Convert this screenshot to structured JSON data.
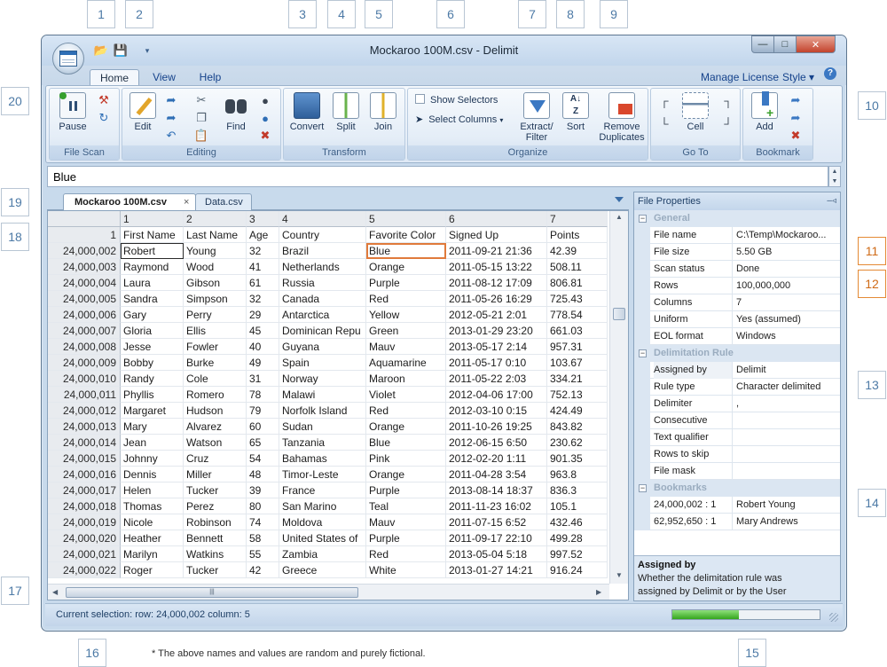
{
  "callouts": [
    "1",
    "2",
    "3",
    "4",
    "5",
    "6",
    "7",
    "8",
    "9",
    "10",
    "11",
    "12",
    "13",
    "14",
    "15",
    "16",
    "17",
    "18",
    "19",
    "20"
  ],
  "window": {
    "title": "Mockaroo 100M.csv - Delimit"
  },
  "tabs": {
    "home": "Home",
    "view": "View",
    "help": "Help",
    "manage_license": "Manage License",
    "style": "Style ▾",
    "help_icon": "?"
  },
  "ribbon": {
    "file_scan": {
      "label": "File Scan",
      "pause": "Pause"
    },
    "editing": {
      "label": "Editing",
      "edit": "Edit",
      "find": "Find"
    },
    "transform": {
      "label": "Transform",
      "convert": "Convert",
      "split": "Split",
      "join": "Join"
    },
    "organize": {
      "label": "Organize",
      "show_selectors": "Show Selectors",
      "select_columns": "Select Columns",
      "extract_filter_1": "Extract/",
      "extract_filter_2": "Filter",
      "sort": "Sort",
      "remove_dup_1": "Remove",
      "remove_dup_2": "Duplicates"
    },
    "goto": {
      "label": "Go To",
      "cell": "Cell"
    },
    "bookmark": {
      "label": "Bookmark",
      "add": "Add"
    }
  },
  "value_bar": {
    "value": "Blue"
  },
  "doc_tabs": {
    "active": "Mockaroo 100M.csv",
    "second": "Data.csv",
    "close": "×"
  },
  "grid": {
    "col_numbers": [
      "1",
      "2",
      "3",
      "4",
      "5",
      "6",
      "7"
    ],
    "header_row_number": "1",
    "headers": [
      "First Name",
      "Last Name",
      "Age",
      "Country",
      "Favorite Color",
      "Signed Up",
      "Points"
    ],
    "rows": [
      [
        "24,000,002",
        "Robert",
        "Young",
        "32",
        "Brazil",
        "Blue",
        "2011-09-21 21:36",
        "42.39"
      ],
      [
        "24,000,003",
        "Raymond",
        "Wood",
        "41",
        "Netherlands",
        "Orange",
        "2011-05-15 13:22",
        "508.11"
      ],
      [
        "24,000,004",
        "Laura",
        "Gibson",
        "61",
        "Russia",
        "Purple",
        "2011-08-12 17:09",
        "806.81"
      ],
      [
        "24,000,005",
        "Sandra",
        "Simpson",
        "32",
        "Canada",
        "Red",
        "2011-05-26 16:29",
        "725.43"
      ],
      [
        "24,000,006",
        "Gary",
        "Perry",
        "29",
        "Antarctica",
        "Yellow",
        "2012-05-21 2:01",
        "778.54"
      ],
      [
        "24,000,007",
        "Gloria",
        "Ellis",
        "45",
        "Dominican Repu",
        "Green",
        "2013-01-29 23:20",
        "661.03"
      ],
      [
        "24,000,008",
        "Jesse",
        "Fowler",
        "40",
        "Guyana",
        "Mauv",
        "2013-05-17 2:14",
        "957.31"
      ],
      [
        "24,000,009",
        "Bobby",
        "Burke",
        "49",
        "Spain",
        "Aquamarine",
        "2011-05-17 0:10",
        "103.67"
      ],
      [
        "24,000,010",
        "Randy",
        "Cole",
        "31",
        "Norway",
        "Maroon",
        "2011-05-22 2:03",
        "334.21"
      ],
      [
        "24,000,011",
        "Phyllis",
        "Romero",
        "78",
        "Malawi",
        "Violet",
        "2012-04-06 17:00",
        "752.13"
      ],
      [
        "24,000,012",
        "Margaret",
        "Hudson",
        "79",
        "Norfolk Island",
        "Red",
        "2012-03-10 0:15",
        "424.49"
      ],
      [
        "24,000,013",
        "Mary",
        "Alvarez",
        "60",
        "Sudan",
        "Orange",
        "2011-10-26 19:25",
        "843.82"
      ],
      [
        "24,000,014",
        "Jean",
        "Watson",
        "65",
        "Tanzania",
        "Blue",
        "2012-06-15 6:50",
        "230.62"
      ],
      [
        "24,000,015",
        "Johnny",
        "Cruz",
        "54",
        "Bahamas",
        "Pink",
        "2012-02-20 1:11",
        "901.35"
      ],
      [
        "24,000,016",
        "Dennis",
        "Miller",
        "48",
        "Timor-Leste",
        "Orange",
        "2011-04-28 3:54",
        "963.8"
      ],
      [
        "24,000,017",
        "Helen",
        "Tucker",
        "39",
        "France",
        "Purple",
        "2013-08-14 18:37",
        "836.3"
      ],
      [
        "24,000,018",
        "Thomas",
        "Perez",
        "80",
        "San Marino",
        "Teal",
        "2011-11-23 16:02",
        "105.1"
      ],
      [
        "24,000,019",
        "Nicole",
        "Robinson",
        "74",
        "Moldova",
        "Mauv",
        "2011-07-15 6:52",
        "432.46"
      ],
      [
        "24,000,020",
        "Heather",
        "Bennett",
        "58",
        "United States of",
        "Purple",
        "2011-09-17 22:10",
        "499.28"
      ],
      [
        "24,000,021",
        "Marilyn",
        "Watkins",
        "55",
        "Zambia",
        "Red",
        "2013-05-04 5:18",
        "997.52"
      ],
      [
        "24,000,022",
        "Roger",
        "Tucker",
        "42",
        "Greece",
        "White",
        "2013-01-27 14:21",
        "916.24"
      ]
    ]
  },
  "properties": {
    "title": "File Properties",
    "pin": "ᵩ",
    "general": {
      "label": "General",
      "rows": [
        {
          "k": "File name",
          "v": "C:\\Temp\\Mockaroo..."
        },
        {
          "k": "File size",
          "v": "5.50 GB"
        },
        {
          "k": "Scan status",
          "v": "Done"
        },
        {
          "k": "Rows",
          "v": "100,000,000"
        },
        {
          "k": "Columns",
          "v": "7"
        },
        {
          "k": "Uniform",
          "v": "Yes (assumed)"
        },
        {
          "k": "EOL format",
          "v": "Windows"
        }
      ]
    },
    "delimitation": {
      "label": "Delimitation Rule",
      "rows": [
        {
          "k": "Assigned by",
          "v": "Delimit"
        },
        {
          "k": "Rule type",
          "v": "Character delimited"
        },
        {
          "k": "Delimiter",
          "v": ","
        },
        {
          "k": "Consecutive",
          "v": ""
        },
        {
          "k": "Text qualifier",
          "v": ""
        },
        {
          "k": "Rows to skip",
          "v": ""
        },
        {
          "k": "File mask",
          "v": ""
        }
      ]
    },
    "bookmarks": {
      "label": "Bookmarks",
      "rows": [
        {
          "k": "24,000,002 : 1",
          "v": "Robert Young"
        },
        {
          "k": "62,952,650 : 1",
          "v": "Mary Andrews"
        }
      ]
    },
    "description": {
      "title": "Assigned by",
      "text_1": "Whether the delimitation rule was",
      "text_2": "assigned by Delimit or by the User"
    }
  },
  "status": {
    "text": "Current selection:   row: 24,000,002    column: 5",
    "progress": 0.45,
    "progress_color": "#34a61d"
  },
  "footnote": "* The above names and values are random and purely fictional.",
  "colors": {
    "accent": "#3b78c3",
    "selection_outline": "#e07a3b",
    "callout_highlight": "#e48a35"
  }
}
